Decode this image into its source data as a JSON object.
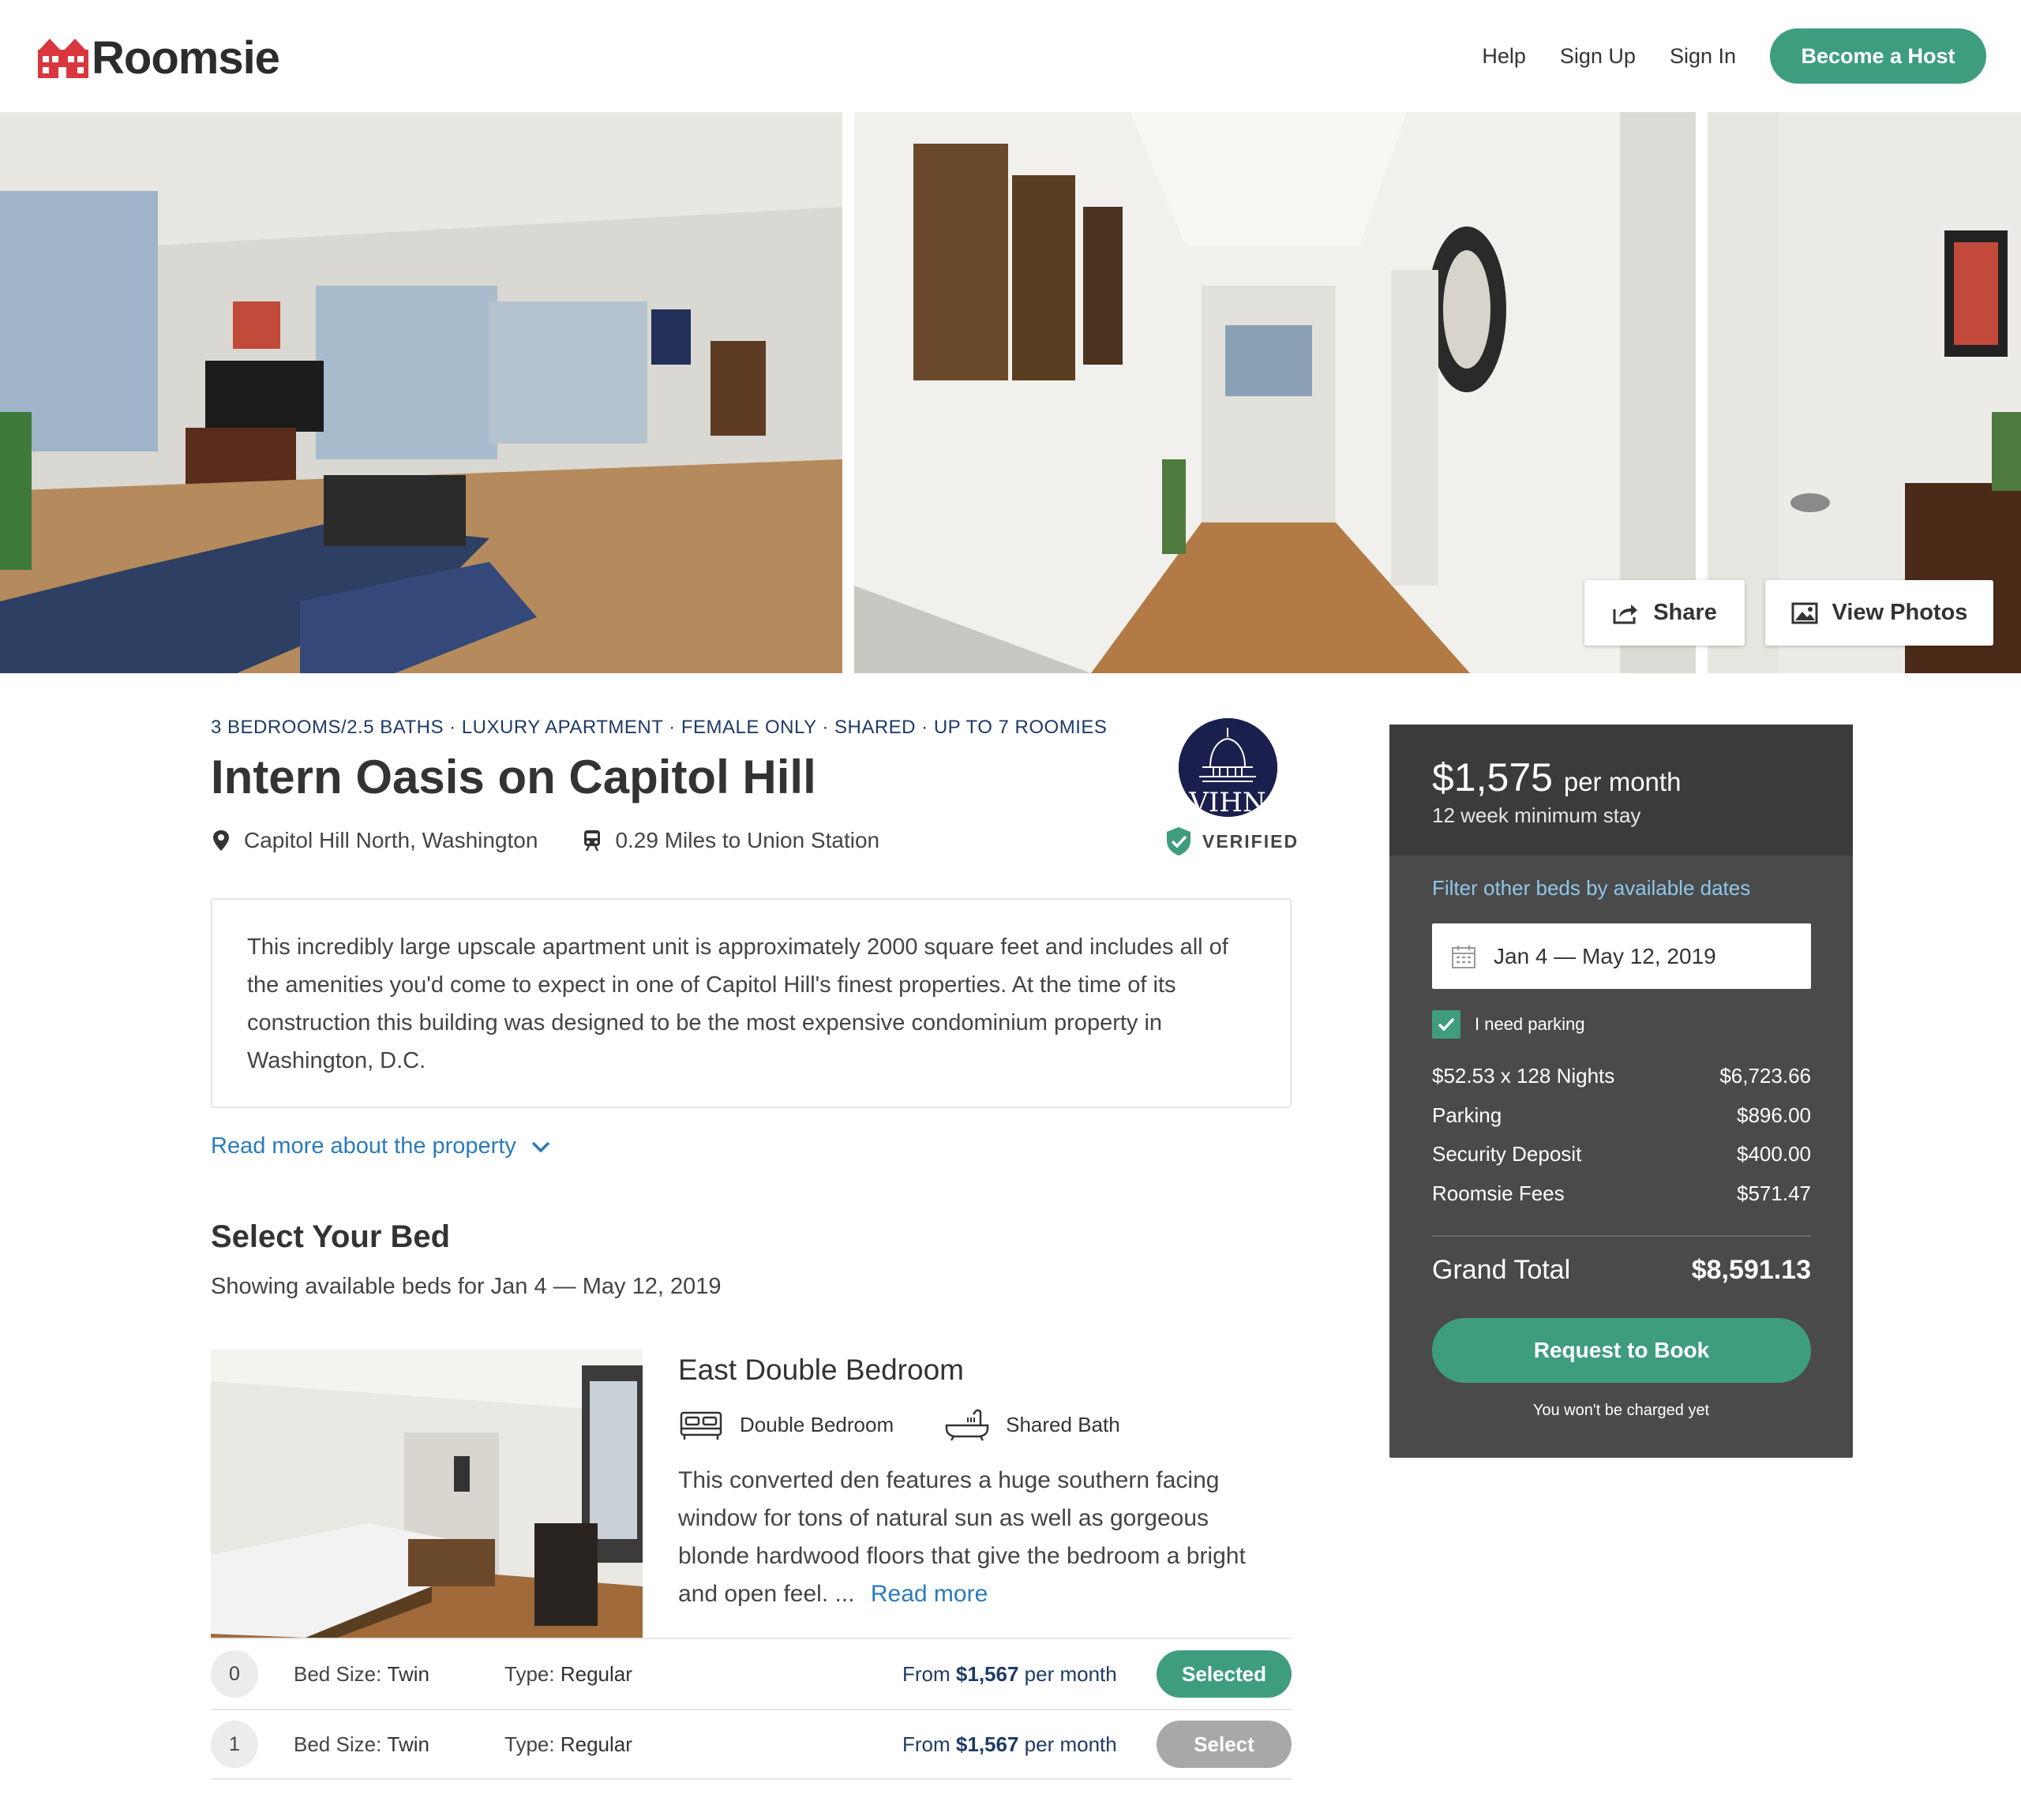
{
  "header": {
    "logo_text": "Roomsie",
    "nav": [
      "Help",
      "Sign Up",
      "Sign In"
    ],
    "host_button": "Become a Host"
  },
  "gallery": {
    "share_label": "Share",
    "view_photos_label": "View Photos"
  },
  "listing": {
    "tagline": "3 BEDROOMS/2.5 BATHS · LUXURY APARTMENT · FEMALE ONLY · SHARED · UP TO 7 ROOMIES",
    "title": "Intern Oasis on Capitol Hill",
    "location": "Capitol Hill North, Washington",
    "transit": "0.29 Miles to Union Station",
    "badge_text": "VIHN",
    "verified_label": "VERIFIED",
    "description": "This incredibly large upscale apartment unit is approximately 2000 square feet and includes all of the amenities you'd come to expect in one of Capitol Hill's finest properties. At the time of its construction this building was designed to be the most expensive condominium property in Washington, D.C.",
    "read_more": "Read more about the property"
  },
  "beds": {
    "section_title": "Select Your Bed",
    "subtitle": "Showing available beds for Jan 4 — May 12, 2019",
    "room": {
      "name": "East Double Bedroom",
      "bed_feature": "Double Bedroom",
      "bath_feature": "Shared Bath",
      "description": "This converted den features a huge southern facing window for tons of natural sun as well as gorgeous blonde hardwood floors that give the bedroom a bright and open feel. ...",
      "read_more": "Read more"
    },
    "rows": [
      {
        "num": "0",
        "size_label": "Bed Size:",
        "size": "Twin",
        "type_label": "Type:",
        "type": "Regular",
        "price_from": "From",
        "price": "$1,567",
        "price_unit": "per month",
        "button": "Selected"
      },
      {
        "num": "1",
        "size_label": "Bed Size:",
        "size": "Twin",
        "type_label": "Type:",
        "type": "Regular",
        "price_from": "From",
        "price": "$1,567",
        "price_unit": "per month",
        "button": "Select"
      }
    ]
  },
  "booking": {
    "price": "$1,575",
    "price_unit": "per month",
    "min_stay": "12 week minimum stay",
    "filter_label": "Filter other beds by available dates",
    "date_range": "Jan 4 — May 12, 2019",
    "parking_label": "I need parking",
    "parking_checked": true,
    "line_items": [
      {
        "label": "$52.53 x 128 Nights",
        "value": "$6,723.66"
      },
      {
        "label": "Parking",
        "value": "$896.00"
      },
      {
        "label": "Security Deposit",
        "value": "$400.00"
      },
      {
        "label": "Roomsie Fees",
        "value": "$571.47"
      }
    ],
    "grand_total_label": "Grand Total",
    "grand_total": "$8,591.13",
    "book_button": "Request to Book",
    "no_charge": "You won't be charged yet"
  },
  "colors": {
    "accent_green": "#3f9d7f",
    "navy": "#1f3a68",
    "link_blue": "#2b7bb9",
    "panel_dark": "#4a4a4a",
    "logo_red": "#d9363e"
  }
}
